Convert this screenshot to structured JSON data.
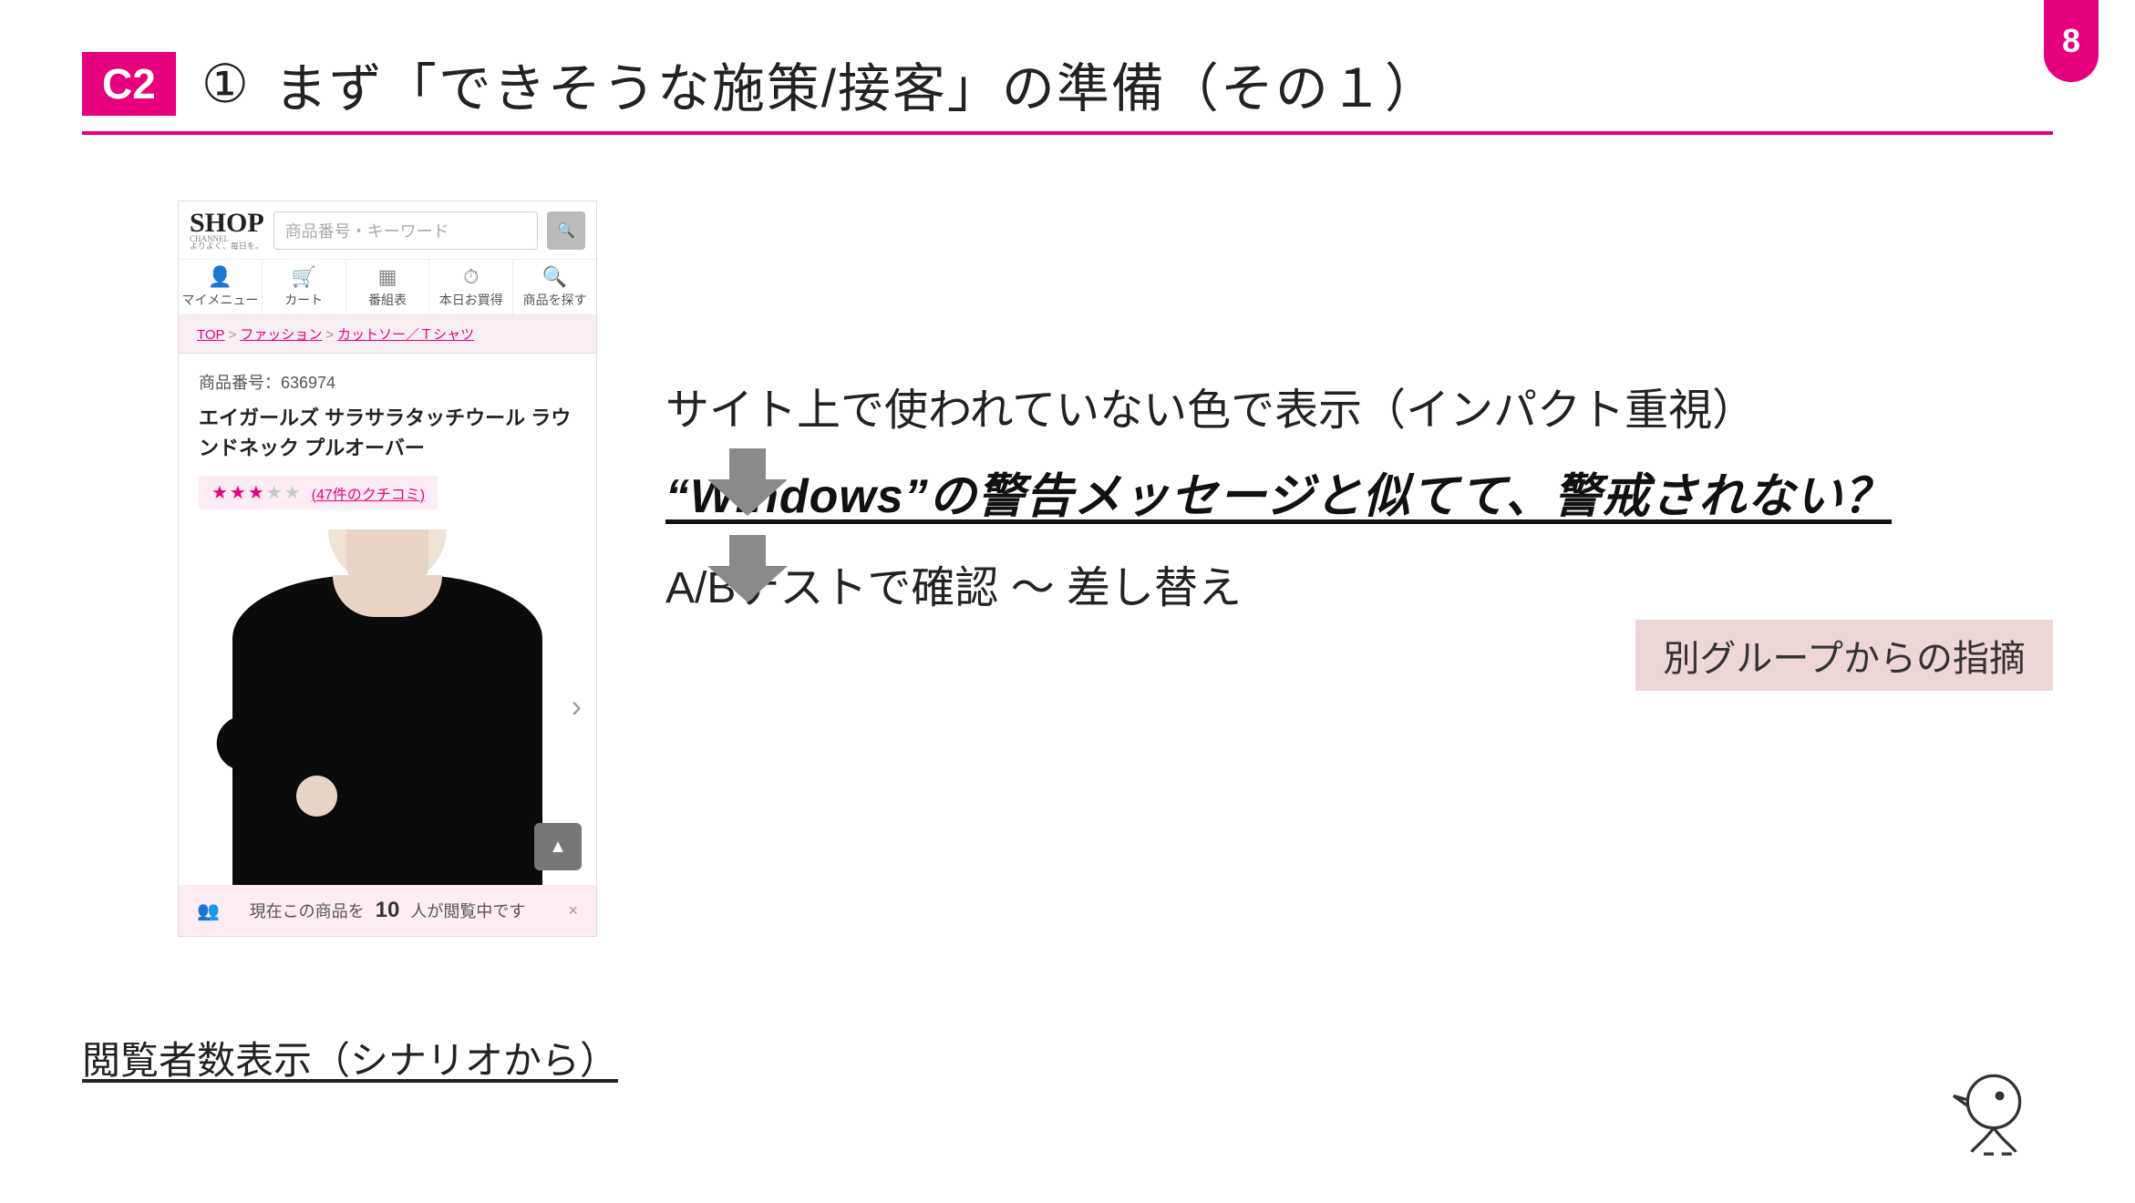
{
  "page_number": "8",
  "header": {
    "badge": "C2",
    "circled_number": "①",
    "title": "まず「できそうな施策/接客」の準備（その１）"
  },
  "mock": {
    "logo_main": "SHOP",
    "logo_sub": "CHANNEL",
    "logo_tagline": "よりよく、毎日を。",
    "search_placeholder": "商品番号・キーワード",
    "nav": {
      "mymenu": "マイメニュー",
      "cart": "カート",
      "schedule": "番組表",
      "deals": "本日お買得",
      "find": "商品を探す"
    },
    "breadcrumb": {
      "top": "TOP",
      "fashion": "ファッション",
      "category": "カットソー／Ｔシャツ"
    },
    "sku_label": "商品番号：",
    "sku_value": "636974",
    "product_name": "エイガールズ サラサラタッチウール ラウンドネック プルオーバー",
    "review_count": "47",
    "review_label_prefix": "(",
    "review_label_suffix": "件のクチコミ)",
    "viewbar_prefix": "現在この商品を",
    "viewbar_count": "10",
    "viewbar_suffix": "人が閲覧中です"
  },
  "caption": "閲覧者数表示（シナリオから）",
  "flow": {
    "line1": "サイト上で使われていない色で表示（インパクト重視）",
    "line2": "“Windows”の警告メッセージと似てて、警戒されない？",
    "tag": "別グループからの指摘",
    "line3": "A/Bテストで確認 〜 差し替え"
  }
}
